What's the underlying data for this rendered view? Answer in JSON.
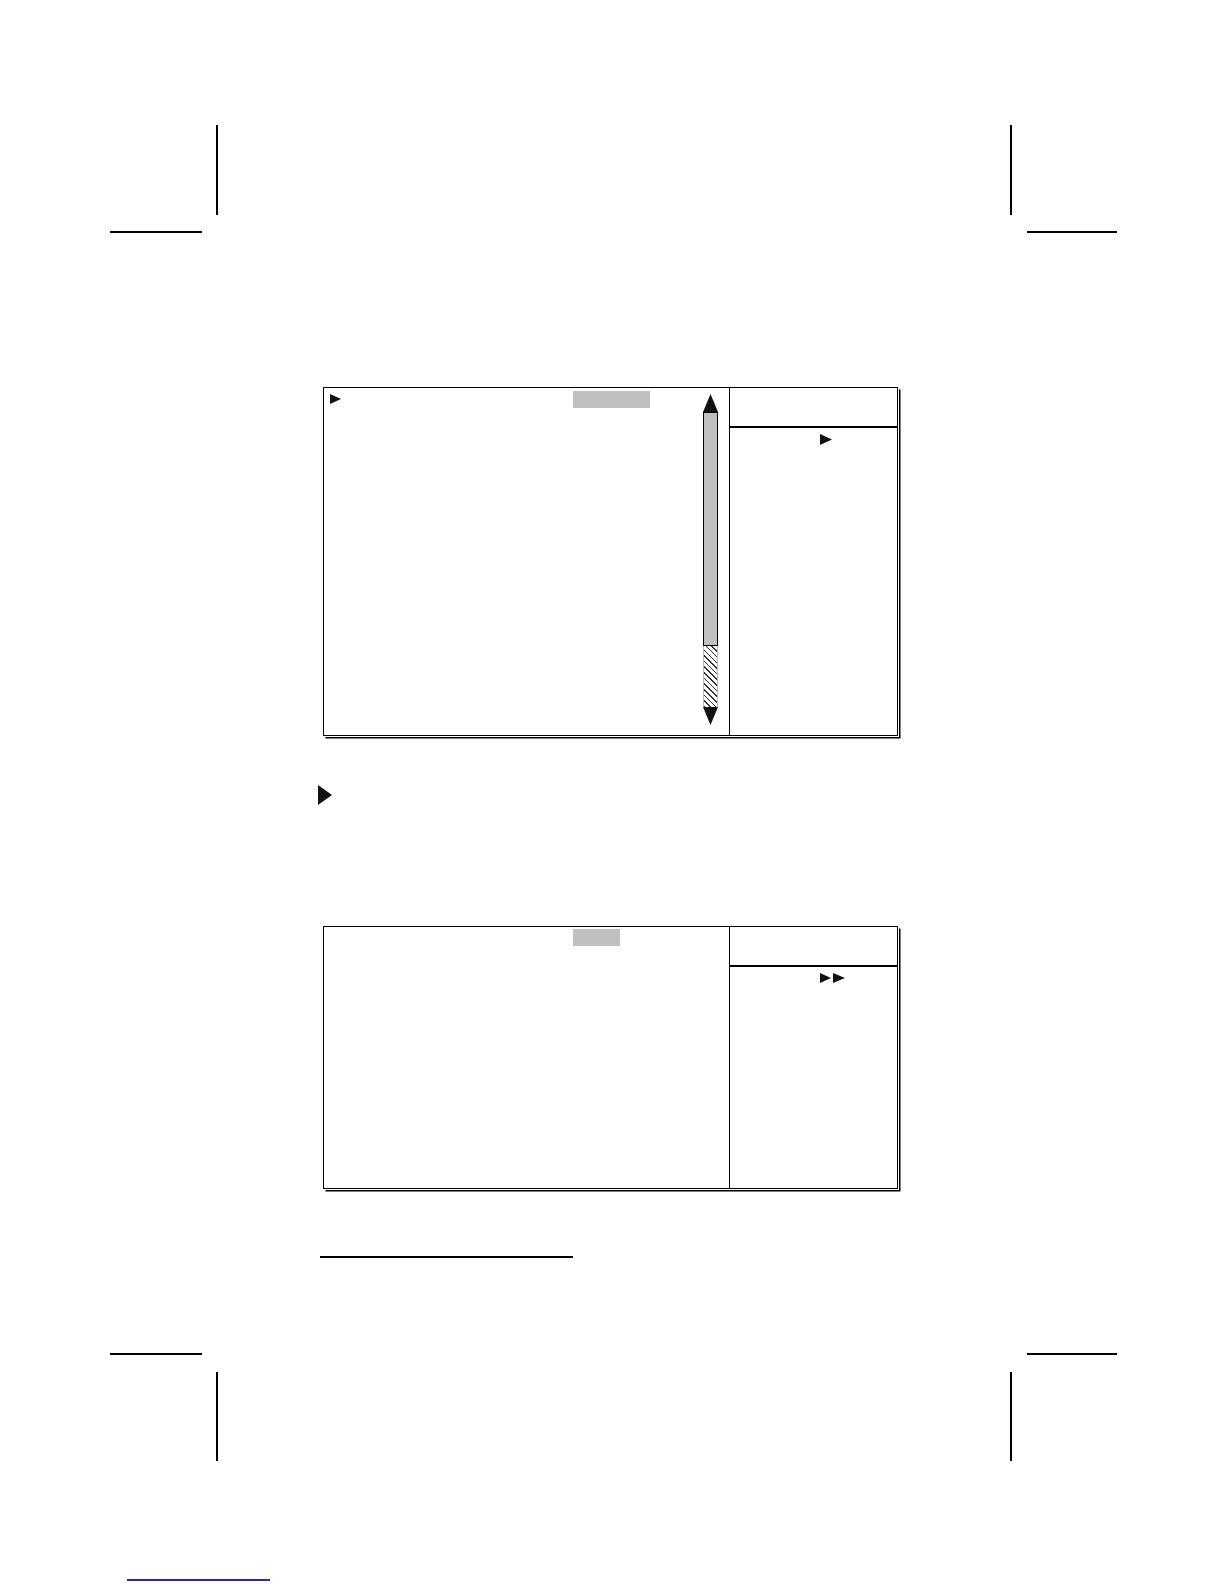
{
  "screens": [
    {
      "kind": "scrolling"
    },
    {
      "kind": "fixed"
    }
  ]
}
